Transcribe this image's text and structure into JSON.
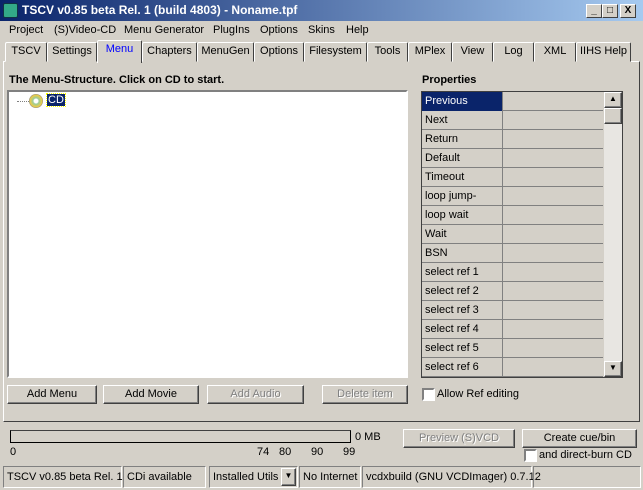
{
  "window": {
    "title": "TSCV v0.85 beta Rel. 1 (build 4803) - Noname.tpf",
    "minimize": "_",
    "maximize": "□",
    "close": "X"
  },
  "menu": [
    "Project",
    "(S)Video-CD",
    "Menu Generator",
    "PlugIns",
    "Options",
    "Skins",
    "Help"
  ],
  "tabs": [
    "TSCV",
    "Settings",
    "Menu",
    "Chapters",
    "MenuGen",
    "Options",
    "Filesystem",
    "Tools",
    "MPlex",
    "View",
    "Log",
    "XML",
    "IIHS Help"
  ],
  "menu_tab": {
    "structure_label": "The Menu-Structure. Click on CD to start.",
    "tree_root": "CD",
    "properties_label": "Properties",
    "properties": [
      "Previous",
      "Next",
      "Return",
      "Default",
      "Timeout",
      "loop jump-timing",
      "loop wait",
      "Wait",
      "BSN",
      "select ref 1",
      "select ref 2",
      "select ref 3",
      "select ref 4",
      "select ref 5",
      "select ref 6"
    ],
    "buttons": {
      "add_menu": "Add Menu",
      "add_movie": "Add Movie",
      "add_audio": "Add Audio",
      "delete_item": "Delete item"
    },
    "allow_ref_editing": "Allow Ref editing"
  },
  "bottom": {
    "size": "0 MB",
    "progress": 0,
    "scale": [
      "0",
      "74",
      "80",
      "90",
      "99"
    ],
    "preview": "Preview (S)VCD",
    "create": "Create cue/bin",
    "burn": "and direct-burn CD"
  },
  "status": {
    "version": "TSCV v0.85 beta Rel. 1",
    "cdi": "CDi available",
    "utils": "Installed Utils",
    "internet": "No Internet",
    "vcdx": "vcdxbuild (GNU VCDImager) 0.7.12"
  }
}
